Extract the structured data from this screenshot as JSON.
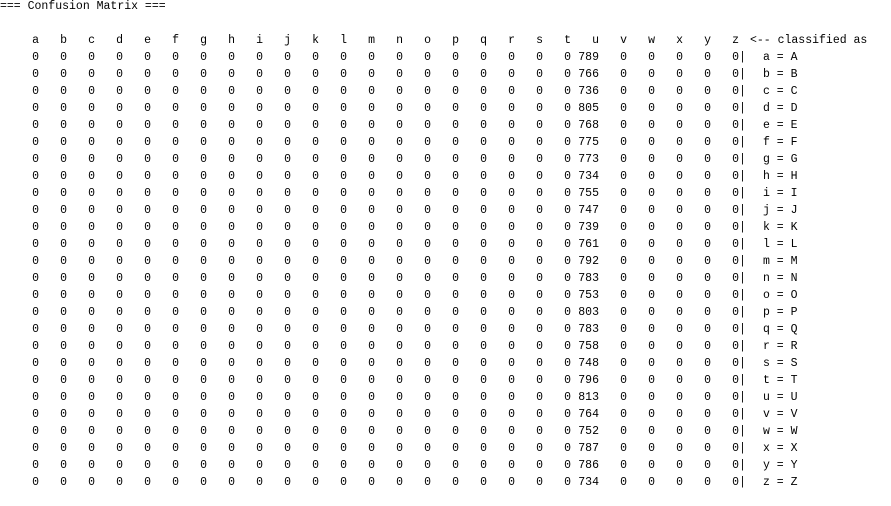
{
  "title": "=== Confusion Matrix ===",
  "columns": [
    "a",
    "b",
    "c",
    "d",
    "e",
    "f",
    "g",
    "h",
    "i",
    "j",
    "k",
    "l",
    "m",
    "n",
    "o",
    "p",
    "q",
    "r",
    "s",
    "t",
    "u",
    "v",
    "w",
    "x",
    "y",
    "z"
  ],
  "header_note": "<-- classified as",
  "separator": "|",
  "rows": [
    {
      "label": "a = A",
      "values": [
        0,
        0,
        0,
        0,
        0,
        0,
        0,
        0,
        0,
        0,
        0,
        0,
        0,
        0,
        0,
        0,
        0,
        0,
        0,
        0,
        789,
        0,
        0,
        0,
        0,
        0
      ]
    },
    {
      "label": "b = B",
      "values": [
        0,
        0,
        0,
        0,
        0,
        0,
        0,
        0,
        0,
        0,
        0,
        0,
        0,
        0,
        0,
        0,
        0,
        0,
        0,
        0,
        766,
        0,
        0,
        0,
        0,
        0
      ]
    },
    {
      "label": "c = C",
      "values": [
        0,
        0,
        0,
        0,
        0,
        0,
        0,
        0,
        0,
        0,
        0,
        0,
        0,
        0,
        0,
        0,
        0,
        0,
        0,
        0,
        736,
        0,
        0,
        0,
        0,
        0
      ]
    },
    {
      "label": "d = D",
      "values": [
        0,
        0,
        0,
        0,
        0,
        0,
        0,
        0,
        0,
        0,
        0,
        0,
        0,
        0,
        0,
        0,
        0,
        0,
        0,
        0,
        805,
        0,
        0,
        0,
        0,
        0
      ]
    },
    {
      "label": "e = E",
      "values": [
        0,
        0,
        0,
        0,
        0,
        0,
        0,
        0,
        0,
        0,
        0,
        0,
        0,
        0,
        0,
        0,
        0,
        0,
        0,
        0,
        768,
        0,
        0,
        0,
        0,
        0
      ]
    },
    {
      "label": "f = F",
      "values": [
        0,
        0,
        0,
        0,
        0,
        0,
        0,
        0,
        0,
        0,
        0,
        0,
        0,
        0,
        0,
        0,
        0,
        0,
        0,
        0,
        775,
        0,
        0,
        0,
        0,
        0
      ]
    },
    {
      "label": "g = G",
      "values": [
        0,
        0,
        0,
        0,
        0,
        0,
        0,
        0,
        0,
        0,
        0,
        0,
        0,
        0,
        0,
        0,
        0,
        0,
        0,
        0,
        773,
        0,
        0,
        0,
        0,
        0
      ]
    },
    {
      "label": "h = H",
      "values": [
        0,
        0,
        0,
        0,
        0,
        0,
        0,
        0,
        0,
        0,
        0,
        0,
        0,
        0,
        0,
        0,
        0,
        0,
        0,
        0,
        734,
        0,
        0,
        0,
        0,
        0
      ]
    },
    {
      "label": "i = I",
      "values": [
        0,
        0,
        0,
        0,
        0,
        0,
        0,
        0,
        0,
        0,
        0,
        0,
        0,
        0,
        0,
        0,
        0,
        0,
        0,
        0,
        755,
        0,
        0,
        0,
        0,
        0
      ]
    },
    {
      "label": "j = J",
      "values": [
        0,
        0,
        0,
        0,
        0,
        0,
        0,
        0,
        0,
        0,
        0,
        0,
        0,
        0,
        0,
        0,
        0,
        0,
        0,
        0,
        747,
        0,
        0,
        0,
        0,
        0
      ]
    },
    {
      "label": "k = K",
      "values": [
        0,
        0,
        0,
        0,
        0,
        0,
        0,
        0,
        0,
        0,
        0,
        0,
        0,
        0,
        0,
        0,
        0,
        0,
        0,
        0,
        739,
        0,
        0,
        0,
        0,
        0
      ]
    },
    {
      "label": "l = L",
      "values": [
        0,
        0,
        0,
        0,
        0,
        0,
        0,
        0,
        0,
        0,
        0,
        0,
        0,
        0,
        0,
        0,
        0,
        0,
        0,
        0,
        761,
        0,
        0,
        0,
        0,
        0
      ]
    },
    {
      "label": "m = M",
      "values": [
        0,
        0,
        0,
        0,
        0,
        0,
        0,
        0,
        0,
        0,
        0,
        0,
        0,
        0,
        0,
        0,
        0,
        0,
        0,
        0,
        792,
        0,
        0,
        0,
        0,
        0
      ]
    },
    {
      "label": "n = N",
      "values": [
        0,
        0,
        0,
        0,
        0,
        0,
        0,
        0,
        0,
        0,
        0,
        0,
        0,
        0,
        0,
        0,
        0,
        0,
        0,
        0,
        783,
        0,
        0,
        0,
        0,
        0
      ]
    },
    {
      "label": "o = O",
      "values": [
        0,
        0,
        0,
        0,
        0,
        0,
        0,
        0,
        0,
        0,
        0,
        0,
        0,
        0,
        0,
        0,
        0,
        0,
        0,
        0,
        753,
        0,
        0,
        0,
        0,
        0
      ]
    },
    {
      "label": "p = P",
      "values": [
        0,
        0,
        0,
        0,
        0,
        0,
        0,
        0,
        0,
        0,
        0,
        0,
        0,
        0,
        0,
        0,
        0,
        0,
        0,
        0,
        803,
        0,
        0,
        0,
        0,
        0
      ]
    },
    {
      "label": "q = Q",
      "values": [
        0,
        0,
        0,
        0,
        0,
        0,
        0,
        0,
        0,
        0,
        0,
        0,
        0,
        0,
        0,
        0,
        0,
        0,
        0,
        0,
        783,
        0,
        0,
        0,
        0,
        0
      ]
    },
    {
      "label": "r = R",
      "values": [
        0,
        0,
        0,
        0,
        0,
        0,
        0,
        0,
        0,
        0,
        0,
        0,
        0,
        0,
        0,
        0,
        0,
        0,
        0,
        0,
        758,
        0,
        0,
        0,
        0,
        0
      ]
    },
    {
      "label": "s = S",
      "values": [
        0,
        0,
        0,
        0,
        0,
        0,
        0,
        0,
        0,
        0,
        0,
        0,
        0,
        0,
        0,
        0,
        0,
        0,
        0,
        0,
        748,
        0,
        0,
        0,
        0,
        0
      ]
    },
    {
      "label": "t = T",
      "values": [
        0,
        0,
        0,
        0,
        0,
        0,
        0,
        0,
        0,
        0,
        0,
        0,
        0,
        0,
        0,
        0,
        0,
        0,
        0,
        0,
        796,
        0,
        0,
        0,
        0,
        0
      ]
    },
    {
      "label": "u = U",
      "values": [
        0,
        0,
        0,
        0,
        0,
        0,
        0,
        0,
        0,
        0,
        0,
        0,
        0,
        0,
        0,
        0,
        0,
        0,
        0,
        0,
        813,
        0,
        0,
        0,
        0,
        0
      ]
    },
    {
      "label": "v = V",
      "values": [
        0,
        0,
        0,
        0,
        0,
        0,
        0,
        0,
        0,
        0,
        0,
        0,
        0,
        0,
        0,
        0,
        0,
        0,
        0,
        0,
        764,
        0,
        0,
        0,
        0,
        0
      ]
    },
    {
      "label": "w = W",
      "values": [
        0,
        0,
        0,
        0,
        0,
        0,
        0,
        0,
        0,
        0,
        0,
        0,
        0,
        0,
        0,
        0,
        0,
        0,
        0,
        0,
        752,
        0,
        0,
        0,
        0,
        0
      ]
    },
    {
      "label": "x = X",
      "values": [
        0,
        0,
        0,
        0,
        0,
        0,
        0,
        0,
        0,
        0,
        0,
        0,
        0,
        0,
        0,
        0,
        0,
        0,
        0,
        0,
        787,
        0,
        0,
        0,
        0,
        0
      ]
    },
    {
      "label": "y = Y",
      "values": [
        0,
        0,
        0,
        0,
        0,
        0,
        0,
        0,
        0,
        0,
        0,
        0,
        0,
        0,
        0,
        0,
        0,
        0,
        0,
        0,
        786,
        0,
        0,
        0,
        0,
        0
      ]
    },
    {
      "label": "z = Z",
      "values": [
        0,
        0,
        0,
        0,
        0,
        0,
        0,
        0,
        0,
        0,
        0,
        0,
        0,
        0,
        0,
        0,
        0,
        0,
        0,
        0,
        734,
        0,
        0,
        0,
        0,
        0
      ]
    }
  ]
}
